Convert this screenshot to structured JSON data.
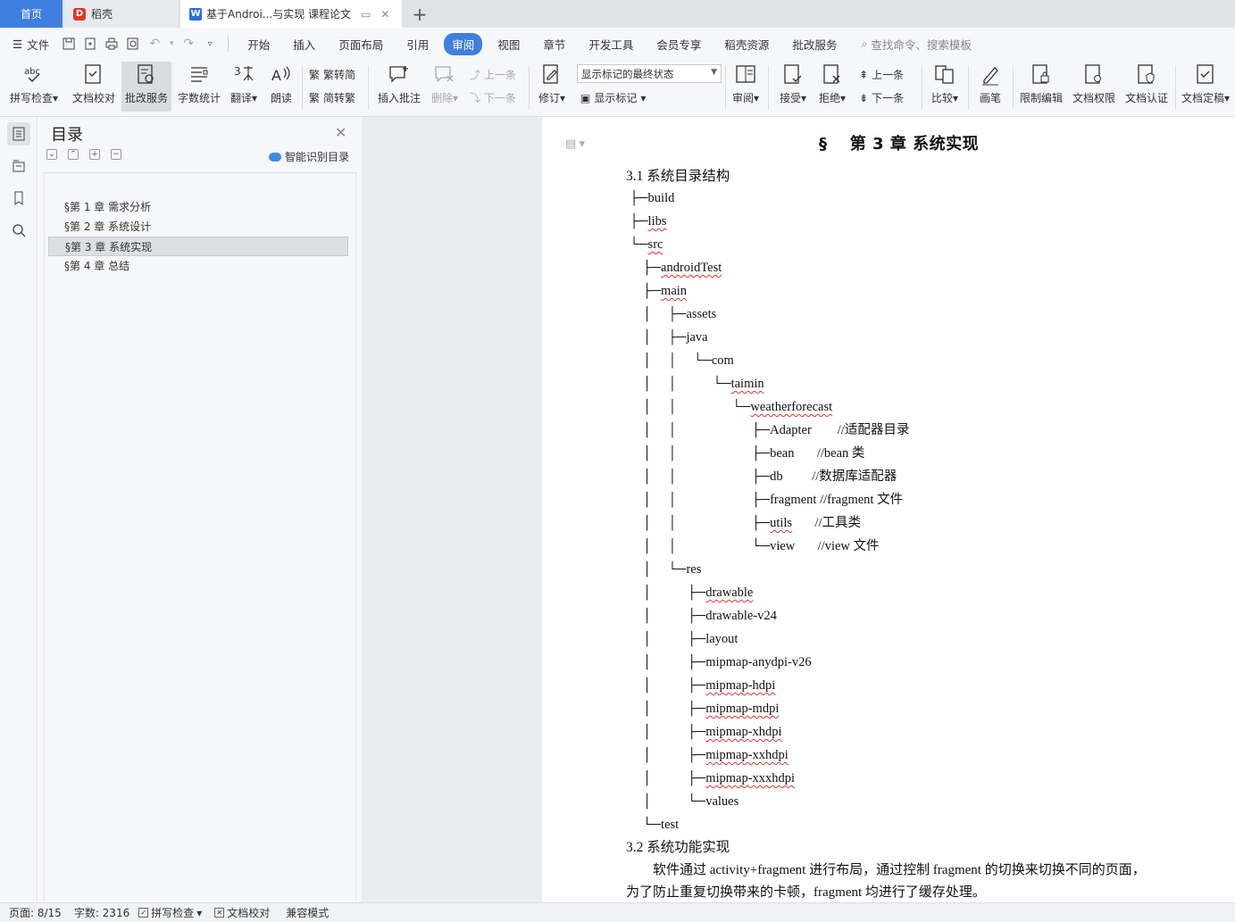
{
  "tabs": {
    "home": "首页",
    "daoke": "稻壳",
    "doc": "基于Androi...与实现 课程论文",
    "plus": "+"
  },
  "menu": {
    "file": "文件",
    "items": [
      "开始",
      "插入",
      "页面布局",
      "引用",
      "审阅",
      "视图",
      "章节",
      "开发工具",
      "会员专享",
      "稻壳资源",
      "批改服务"
    ],
    "active": "审阅",
    "search": "查找命令、搜索模板"
  },
  "ribbon": {
    "spell": "拼写检查",
    "proof": "文档校对",
    "review_service": "批改服务",
    "wordcount": "字数统计",
    "translate": "翻译",
    "read": "朗读",
    "trad": "繁转简",
    "simp": "简转繁",
    "insert_comment": "插入批注",
    "delete": "删除",
    "prev_comment": "上一条",
    "next_comment": "下一条",
    "revise": "修订",
    "mark_state": "显示标记的最终状态",
    "show_marks": "显示标记",
    "review": "审阅",
    "accept": "接受",
    "reject": "拒绝",
    "prev": "上一条",
    "next": "下一条",
    "compare": "比较",
    "pen": "画笔",
    "restrict": "限制编辑",
    "perm": "文档权限",
    "auth": "文档认证",
    "finalize": "文档定稿"
  },
  "toc": {
    "title": "目录",
    "ai": "智能识别目录",
    "items": [
      "§第 1 章 需求分析",
      "§第 2 章 系统设计",
      "§第 3 章 系统实现",
      "§第 4 章 总结"
    ]
  },
  "doc": {
    "chapter": "§　 第 3 章 系统实现",
    "sec31": "3.1  系统目录结构",
    "tree": [
      {
        "p": "├─",
        "t": "build",
        "u": false,
        "c": ""
      },
      {
        "p": "├─",
        "t": "libs",
        "u": true,
        "c": ""
      },
      {
        "p": "└─",
        "t": "src",
        "u": true,
        "c": ""
      },
      {
        "p": "    ├─",
        "t": "androidTest",
        "u": true,
        "c": ""
      },
      {
        "p": "    ├─",
        "t": "main",
        "u": true,
        "c": ""
      },
      {
        "p": "    │     ├─",
        "t": "assets",
        "u": false,
        "c": ""
      },
      {
        "p": "    │     ├─",
        "t": "java",
        "u": false,
        "c": ""
      },
      {
        "p": "    │     │     └─",
        "t": "com",
        "u": false,
        "c": ""
      },
      {
        "p": "    │     │           └─",
        "t": "taimin",
        "u": true,
        "c": ""
      },
      {
        "p": "    │     │                 └─",
        "t": "weatherforecast",
        "u": true,
        "c": ""
      },
      {
        "p": "    │     │                       ├─",
        "t": "Adapter",
        "u": false,
        "c": "        //适配器目录"
      },
      {
        "p": "    │     │                       ├─",
        "t": "bean",
        "u": false,
        "c": "       //bean 类"
      },
      {
        "p": "    │     │                       ├─",
        "t": "db",
        "u": false,
        "c": "         //数据库适配器"
      },
      {
        "p": "    │     │                       ├─",
        "t": "fragment",
        "u": false,
        "c": " //fragment 文件"
      },
      {
        "p": "    │     │                       ├─",
        "t": "utils",
        "u": true,
        "c": "       //工具类"
      },
      {
        "p": "    │     │                       └─",
        "t": "view",
        "u": false,
        "c": "       //view 文件"
      },
      {
        "p": "    │     └─",
        "t": "res",
        "u": false,
        "c": ""
      },
      {
        "p": "    │           ├─",
        "t": "drawable",
        "u": true,
        "c": ""
      },
      {
        "p": "    │           ├─",
        "t": "drawable-v24",
        "u": false,
        "c": ""
      },
      {
        "p": "    │           ├─",
        "t": "layout",
        "u": false,
        "c": ""
      },
      {
        "p": "    │           ├─",
        "t": "mipmap-anydpi-v26",
        "u": false,
        "c": ""
      },
      {
        "p": "    │           ├─",
        "t": "mipmap-hdpi",
        "u": true,
        "c": ""
      },
      {
        "p": "    │           ├─",
        "t": "mipmap-mdpi",
        "u": true,
        "c": ""
      },
      {
        "p": "    │           ├─",
        "t": "mipmap-xhdpi",
        "u": true,
        "c": ""
      },
      {
        "p": "    │           ├─",
        "t": "mipmap-xxhdpi",
        "u": true,
        "c": ""
      },
      {
        "p": "    │           ├─",
        "t": "mipmap-xxxhdpi",
        "u": true,
        "c": ""
      },
      {
        "p": "    │           └─",
        "t": "values",
        "u": false,
        "c": ""
      },
      {
        "p": "    └─",
        "t": "test",
        "u": false,
        "c": ""
      }
    ],
    "sec32": "3.2  系统功能实现",
    "para1": "　　软件通过 activity+fragment 进行布局，通过控制 fragment 的切换来切换不同的页面，",
    "para2": "为了防止重复切换带来的卡顿，fragment 均进行了缓存处理。"
  },
  "status": {
    "page": "页面: 8/15",
    "words": "字数: 2316",
    "spell": "拼写检查",
    "proof": "文档校对",
    "compat": "兼容模式"
  }
}
